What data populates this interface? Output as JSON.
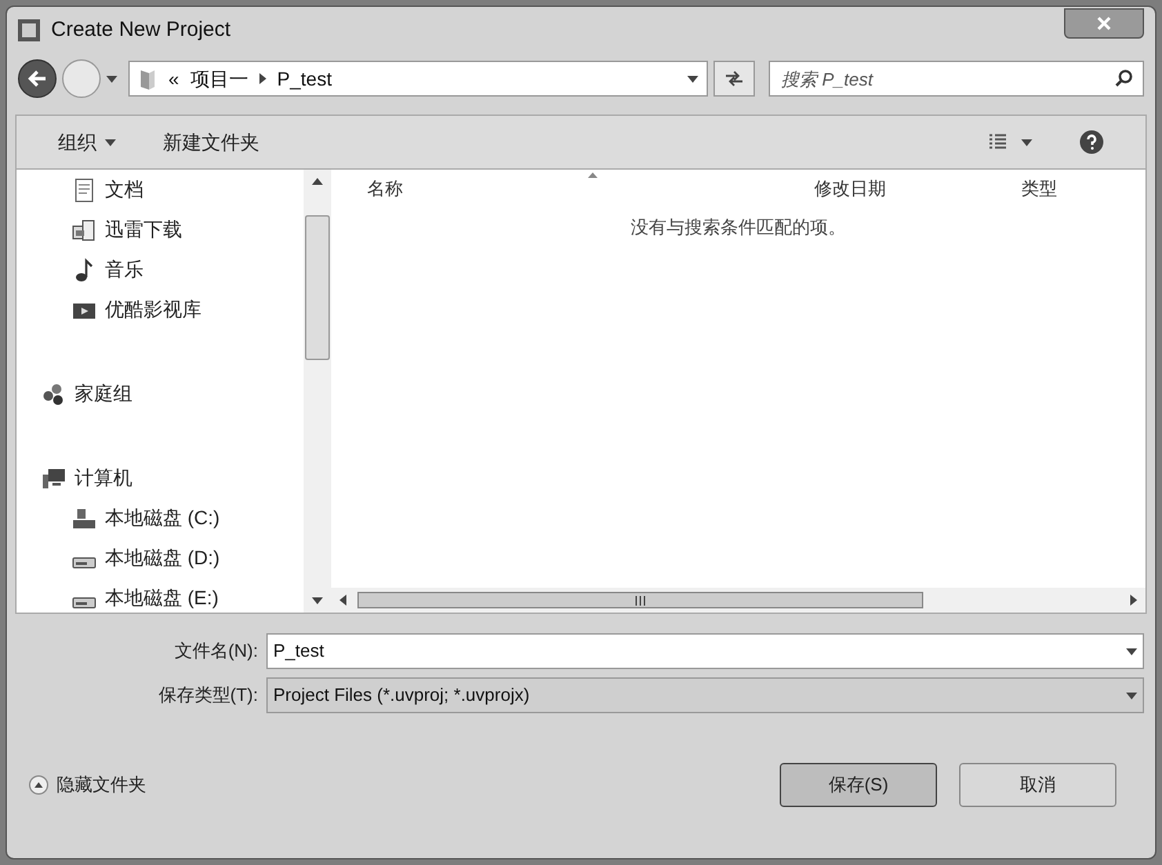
{
  "window": {
    "title": "Create New Project"
  },
  "address": {
    "crumbs": [
      "«",
      "项目一",
      "P_test"
    ]
  },
  "search": {
    "placeholder": "搜索 P_test"
  },
  "toolbar": {
    "organize": "组织",
    "new_folder": "新建文件夹"
  },
  "sidebar": {
    "sections": [
      {
        "items": [
          {
            "label": "文档",
            "kind": "document"
          },
          {
            "label": "迅雷下载",
            "kind": "download"
          },
          {
            "label": "音乐",
            "kind": "music"
          },
          {
            "label": "优酷影视库",
            "kind": "video"
          }
        ]
      },
      {
        "items": [
          {
            "label": "家庭组",
            "kind": "homegroup"
          }
        ]
      },
      {
        "items": [
          {
            "label": "计算机",
            "kind": "computer",
            "children": [
              {
                "label": "本地磁盘 (C:)",
                "kind": "system-drive"
              },
              {
                "label": "本地磁盘 (D:)",
                "kind": "drive"
              },
              {
                "label": "本地磁盘 (E:)",
                "kind": "drive"
              }
            ]
          }
        ]
      }
    ]
  },
  "table": {
    "columns": [
      "名称",
      "修改日期",
      "类型"
    ],
    "empty_message": "没有与搜索条件匹配的项。"
  },
  "file_name": {
    "label": "文件名(N):",
    "value": "P_test"
  },
  "file_type": {
    "label": "保存类型(T):",
    "value": "Project Files (*.uvproj; *.uvprojx)"
  },
  "hide_folders": "隐藏文件夹",
  "buttons": [
    {
      "label": "保存(S)",
      "kind": "primary"
    },
    {
      "label": "取消",
      "kind": "normal"
    }
  ]
}
